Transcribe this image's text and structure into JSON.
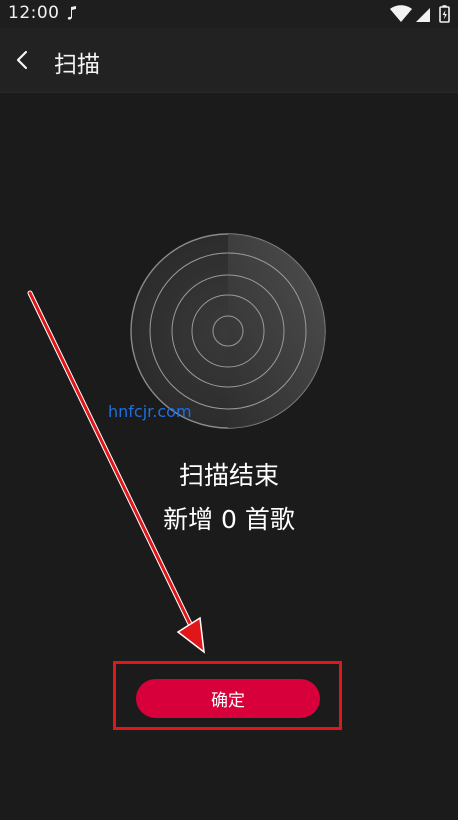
{
  "status_bar": {
    "time": "12:00",
    "icons": [
      "music-note-icon",
      "wifi-icon",
      "signal-icon",
      "battery-icon"
    ]
  },
  "app_bar": {
    "title": "扫描",
    "back_icon": "chevron-left-icon"
  },
  "scan": {
    "status": "扫描结束",
    "result": "新增 0 首歌"
  },
  "watermark": "hnfcjr.com",
  "actions": {
    "confirm_label": "确定"
  },
  "colors": {
    "background": "#1b1b1b",
    "app_bar": "#222222",
    "accent": "#d7003a",
    "annotation": "#e0161b",
    "watermark": "#1e6fe0"
  }
}
